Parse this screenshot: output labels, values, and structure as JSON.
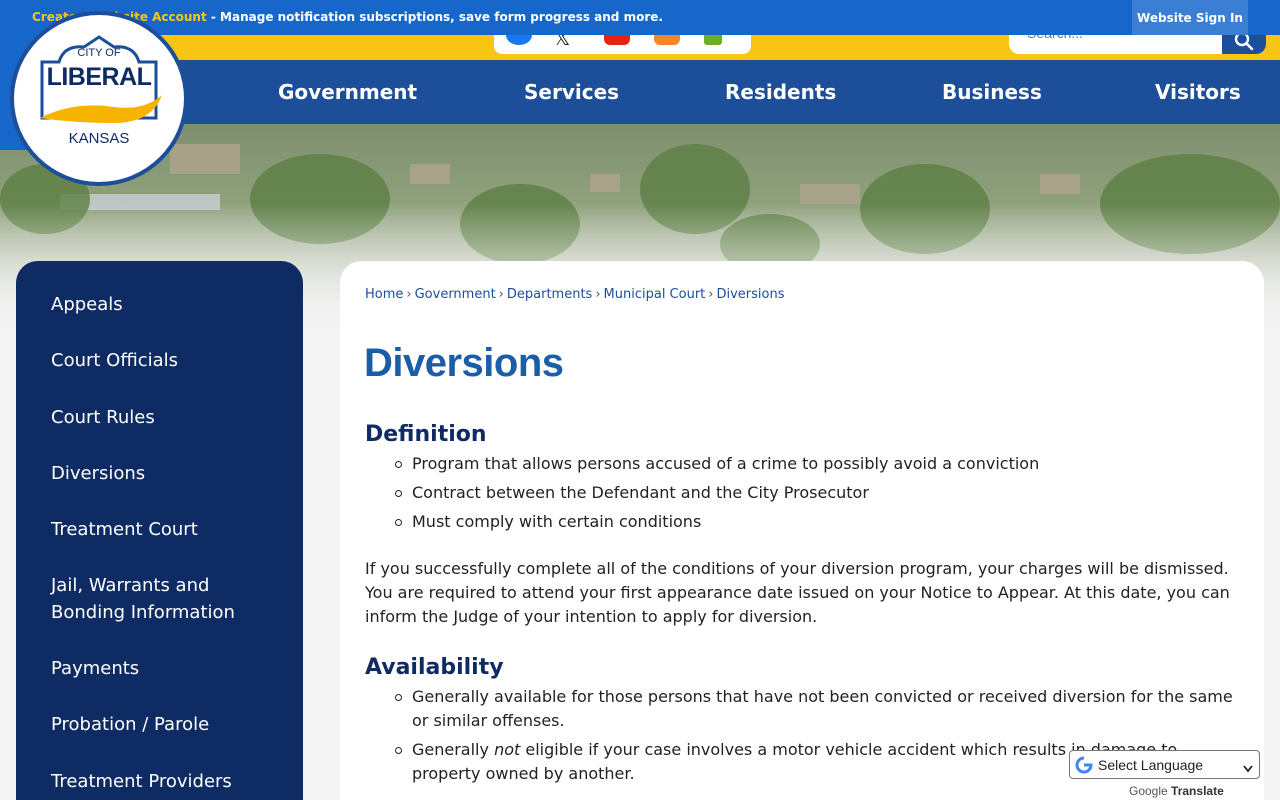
{
  "topbar": {
    "account_link": "Create a Website Account",
    "message": " - Manage notification subscriptions, save form progress and more.",
    "signin": "Website Sign In"
  },
  "search": {
    "placeholder": "Search..."
  },
  "logo": {
    "line1": "CITY OF",
    "line2": "LIBERAL",
    "line3": "KANSAS"
  },
  "nav": {
    "items": [
      {
        "label": "Government"
      },
      {
        "label": "Services"
      },
      {
        "label": "Residents"
      },
      {
        "label": "Business"
      },
      {
        "label": "Visitors"
      }
    ]
  },
  "sidebar": {
    "items": [
      {
        "label": "Appeals"
      },
      {
        "label": "Court Officials"
      },
      {
        "label": "Court Rules"
      },
      {
        "label": "Diversions"
      },
      {
        "label": "Treatment Court"
      },
      {
        "label": "Jail, Warrants and Bonding Information"
      },
      {
        "label": "Payments"
      },
      {
        "label": "Probation / Parole"
      },
      {
        "label": "Treatment Providers"
      }
    ]
  },
  "breadcrumb": {
    "items": [
      {
        "label": "Home"
      },
      {
        "label": "Government"
      },
      {
        "label": "Departments"
      },
      {
        "label": "Municipal Court"
      },
      {
        "label": "Diversions"
      }
    ],
    "separator": "›"
  },
  "content": {
    "title": "Diversions",
    "definition": {
      "heading": "Definition",
      "items": [
        "Program that allows persons accused of a crime to possibly avoid a conviction",
        "Contract between the Defendant and the City Prosecutor",
        "Must comply with certain conditions"
      ]
    },
    "paragraph": "If you successfully complete all of the conditions of your diversion program, your charges will be dismissed. You are required to attend your first appearance date issued on your Notice to Appear. At this date, you can inform the Judge of your intention to apply for diversion.",
    "availability": {
      "heading": "Availability",
      "item1": "Generally available for those persons that have not been convicted or received diversion for the same or similar offenses.",
      "item2_pre": "Generally ",
      "item2_em": "not",
      "item2_post": " eligible if your case involves a motor vehicle accident which results in damage to property owned by another."
    }
  },
  "translate": {
    "label": "Select Language",
    "powered_by": "Google",
    "powered_word": "Translate"
  },
  "colors": {
    "topbar": "#1667c9",
    "yellow": "#f9c514",
    "nav": "#1c4e9a",
    "sidebar": "#0e2c63",
    "title": "#1b5ea8"
  }
}
